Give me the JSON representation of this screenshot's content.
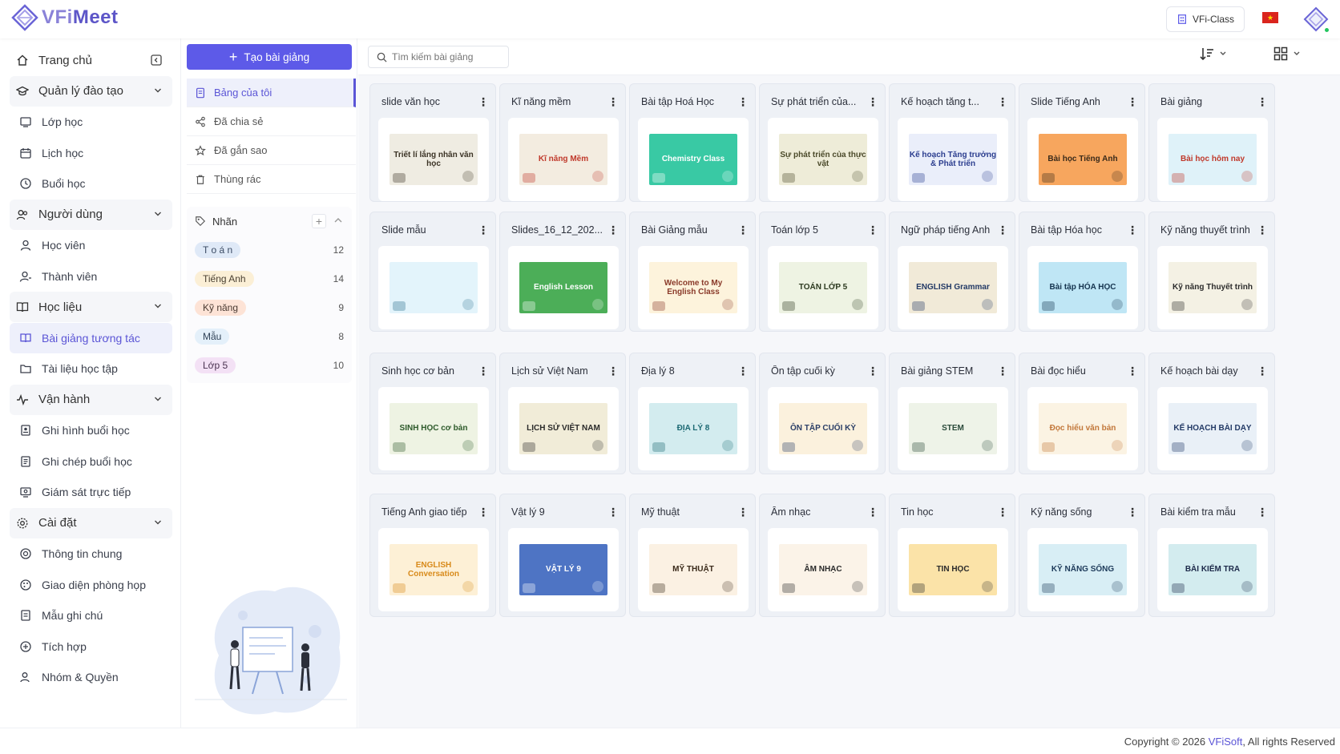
{
  "header": {
    "logo_prefix": "VFi",
    "logo_suffix": "Meet",
    "class_badge": "VFi-Class",
    "flag_star": "★"
  },
  "sidebar": {
    "items": [
      {
        "label": "Trang chủ",
        "type": "top",
        "icon": "home-icon"
      },
      {
        "label": "Quản lý đào tạo",
        "type": "group",
        "icon": "graduation-icon"
      },
      {
        "label": "Lớp học",
        "type": "sub",
        "icon": "classroom-icon"
      },
      {
        "label": "Lịch học",
        "type": "sub",
        "icon": "calendar-icon"
      },
      {
        "label": "Buổi học",
        "type": "sub",
        "icon": "session-icon"
      },
      {
        "label": "Người dùng",
        "type": "group",
        "icon": "users-icon"
      },
      {
        "label": "Học viên",
        "type": "sub",
        "icon": "student-icon"
      },
      {
        "label": "Thành viên",
        "type": "sub",
        "icon": "member-icon"
      },
      {
        "label": "Học liệu",
        "type": "group",
        "icon": "book-icon"
      },
      {
        "label": "Bài giảng tương tác",
        "type": "sub-active",
        "icon": "interactive-lesson-icon"
      },
      {
        "label": "Tài liệu học tập",
        "type": "sub",
        "icon": "folder-icon"
      },
      {
        "label": "Vận hành",
        "type": "group",
        "icon": "activity-icon"
      },
      {
        "label": "Ghi hình buổi học",
        "type": "sub",
        "icon": "video-icon"
      },
      {
        "label": "Ghi chép buổi học",
        "type": "sub",
        "icon": "notes-icon"
      },
      {
        "label": "Giám sát trực tiếp",
        "type": "sub",
        "icon": "monitor-icon"
      },
      {
        "label": "Cài đặt",
        "type": "group",
        "icon": "settings-icon"
      },
      {
        "label": "Thông tin chung",
        "type": "sub",
        "icon": "info-icon"
      },
      {
        "label": "Giao diện phòng họp",
        "type": "sub",
        "icon": "palette-icon"
      },
      {
        "label": "Mẫu ghi chú",
        "type": "sub",
        "icon": "template-icon"
      },
      {
        "label": "Tích hợp",
        "type": "sub",
        "icon": "integration-icon"
      },
      {
        "label": "Nhóm & Quyền",
        "type": "sub",
        "icon": "group-permission-icon"
      }
    ]
  },
  "midpanel": {
    "create_label": "Tạo bài giảng",
    "create_plus": "+",
    "nav": [
      {
        "label": "Bảng của tôi",
        "icon": "my-board-icon",
        "active": true
      },
      {
        "label": "Đã chia sẻ",
        "icon": "share-icon",
        "active": false
      },
      {
        "label": "Đã gắn sao",
        "icon": "star-icon",
        "active": false
      },
      {
        "label": "Thùng rác",
        "icon": "trash-icon",
        "active": false
      }
    ],
    "labels_title": "Nhãn",
    "labels_add": "+",
    "tags": [
      {
        "label": "T o á n",
        "count": "12",
        "bg": "#dfe9f7",
        "color": "#3a4a63"
      },
      {
        "label": "Tiếng Anh",
        "count": "14",
        "bg": "#fbefd6",
        "color": "#4a4032"
      },
      {
        "label": "Kỹ năng",
        "count": "9",
        "bg": "#fde3d6",
        "color": "#4a3a32"
      },
      {
        "label": "Mẫu",
        "count": "8",
        "bg": "#e4f0fa",
        "color": "#2f4257"
      },
      {
        "label": "Lớp 5",
        "count": "10",
        "bg": "#f3e1f5",
        "color": "#4a3250"
      }
    ]
  },
  "toolbar": {
    "search_placeholder": "Tìm kiếm bài giảng"
  },
  "lessons": [
    {
      "title": "slide văn học",
      "thumb": "Triết lí lắng nhân văn học",
      "bg": "#efece2",
      "fg": "#3b3325"
    },
    {
      "title": "Kĩ năng mềm",
      "thumb": "Kĩ năng Mềm",
      "bg": "#f3ece0",
      "fg": "#c0392b"
    },
    {
      "title": "Bài tập Hoá Học",
      "thumb": "Chemistry Class",
      "bg": "#39c9a4",
      "fg": "#ffffff"
    },
    {
      "title": "Sự phát triển của...",
      "thumb": "Sự phát triển của thực vật",
      "bg": "#eeecd8",
      "fg": "#4b4a2a"
    },
    {
      "title": "Kế hoạch tăng t...",
      "thumb": "Kế hoạch Tăng trưởng & Phát triển",
      "bg": "#eaeefa",
      "fg": "#2c3e8f"
    },
    {
      "title": "Slide Tiếng Anh",
      "thumb": "Bài học Tiếng Anh",
      "bg": "#f7a65e",
      "fg": "#3a2a1a"
    },
    {
      "title": "Bài giảng",
      "thumb": "Bài học hôm nay",
      "bg": "#dff2f9",
      "fg": "#c0392b"
    },
    {
      "title": "Slide mẫu",
      "thumb": "",
      "bg": "#e3f4fb",
      "fg": "#2a6f8f"
    },
    {
      "title": "Slides_16_12_202...",
      "thumb": "English Lesson",
      "bg": "#4cae58",
      "fg": "#ffffff"
    },
    {
      "title": "Bài Giảng mẫu",
      "thumb": "Welcome to My English Class",
      "bg": "#fdf3dc",
      "fg": "#8a3a2a"
    },
    {
      "title": "Toán lớp 5",
      "thumb": "TOÁN LỚP 5",
      "bg": "#eef3e3",
      "fg": "#2d3a20"
    },
    {
      "title": "Ngữ pháp tiếng Anh",
      "thumb": "ENGLISH Grammar",
      "bg": "#f1ead8",
      "fg": "#233a66"
    },
    {
      "title": "Bài tập Hóa học",
      "thumb": "Bài tập HÓA HỌC",
      "bg": "#bfe6f5",
      "fg": "#15344f"
    },
    {
      "title": "Kỹ năng thuyết trình",
      "thumb": "Kỹ năng Thuyết trình",
      "bg": "#f4f1e4",
      "fg": "#2c2c2c"
    },
    {
      "title": "Sinh học cơ bản",
      "thumb": "SINH HỌC cơ bản",
      "bg": "#eef3e3",
      "fg": "#2d5a2a"
    },
    {
      "title": "Lịch sử Việt Nam",
      "thumb": "LỊCH SỬ VIỆT NAM",
      "bg": "#f1ecd8",
      "fg": "#2a2a2a"
    },
    {
      "title": "Địa lý 8",
      "thumb": "ĐỊA LÝ 8",
      "bg": "#d3ecef",
      "fg": "#1d6a74"
    },
    {
      "title": "Ôn tập cuối kỳ",
      "thumb": "ÔN TẬP CUỐI KỲ",
      "bg": "#fbf1dd",
      "fg": "#2a3e66"
    },
    {
      "title": "Bài giảng STEM",
      "thumb": "STEM",
      "bg": "#eef3e8",
      "fg": "#2a4a3a"
    },
    {
      "title": "Bài đọc hiểu",
      "thumb": "Đọc hiểu văn bản",
      "bg": "#fbf3e3",
      "fg": "#c2773a"
    },
    {
      "title": "Kế hoạch bài dạy",
      "thumb": "KẾ HOẠCH BÀI DẠY",
      "bg": "#e9f0f7",
      "fg": "#233a66"
    },
    {
      "title": "Tiếng Anh giao tiếp",
      "thumb": "ENGLISH Conversation",
      "bg": "#fdf0d6",
      "fg": "#d88a1a"
    },
    {
      "title": "Vật lý 9",
      "thumb": "VẬT LÝ 9",
      "bg": "#4e74c4",
      "fg": "#ffffff"
    },
    {
      "title": "Mỹ thuật",
      "thumb": "MỸ THUẬT",
      "bg": "#fbf1e3",
      "fg": "#3a2a1a"
    },
    {
      "title": "Âm nhạc",
      "thumb": "ÂM NHẠC",
      "bg": "#fbf3e8",
      "fg": "#2a2a2a"
    },
    {
      "title": "Tin học",
      "thumb": "TIN HỌC",
      "bg": "#fbe3a8",
      "fg": "#2a2a2a"
    },
    {
      "title": "Kỹ năng sống",
      "thumb": "KỸ NĂNG SỐNG",
      "bg": "#d8eef5",
      "fg": "#1d3a5a"
    },
    {
      "title": "Bài kiểm tra mẫu",
      "thumb": "BÀI KIỂM TRA",
      "bg": "#d3ecef",
      "fg": "#1d2a4a"
    }
  ],
  "card_menu": "⋮",
  "footer": {
    "copyright_prefix": "Copyright © 2026 ",
    "brand": "VFiSoft",
    "copyright_suffix": ", All rights Reserved"
  }
}
